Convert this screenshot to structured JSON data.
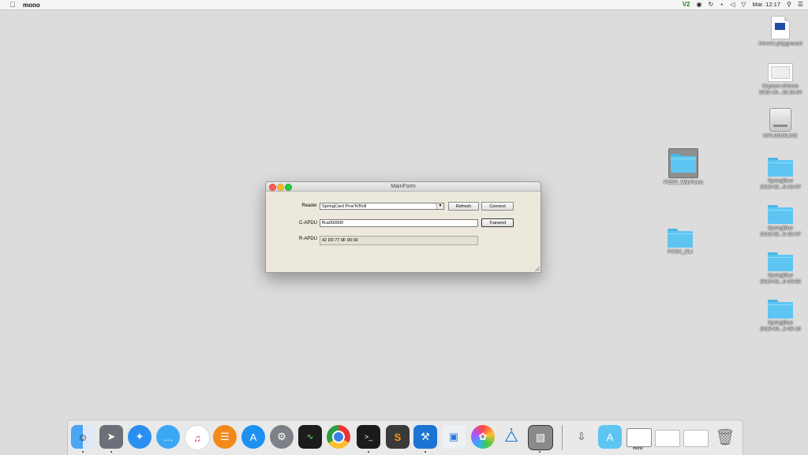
{
  "menubar": {
    "app_name": "mono",
    "vpn_label": "V2",
    "clock": "Mar. 12:17"
  },
  "desktop": {
    "icons": [
      {
        "label": "Herve1.playground"
      },
      {
        "label": "Capture d'écran"
      },
      {
        "label": "2015-10...16.15.04"
      },
      {
        "label": "MYLINUXLIVE"
      },
      {
        "label": "PCSC_WinForm"
      },
      {
        "label": "PCSC_CLI"
      },
      {
        "label": "SpringBlue"
      },
      {
        "label": "2016-02...6-18-07"
      },
      {
        "label": "SpringBlue"
      },
      {
        "label": "2016-02...5-32-07"
      },
      {
        "label": "SpringBlue"
      },
      {
        "label": "2016-02...0-06-53"
      },
      {
        "label": "SpringBlue"
      },
      {
        "label": "2016-03...2-05-19"
      }
    ]
  },
  "window": {
    "title": "MainForm",
    "reader_label": "Reader",
    "reader_value": "SpringCard Prox'N'Roll",
    "refresh_label": "Refresh",
    "connect_label": "Connect",
    "capdu_label": "C-APDU",
    "capdu_value": "ffca000000",
    "transmit_label": "Transmit",
    "rapdu_label": "R-APDU",
    "rapdu_value": "42 D0 77 9F 90 00"
  },
  "dock": {
    "mono_label": "mono"
  }
}
